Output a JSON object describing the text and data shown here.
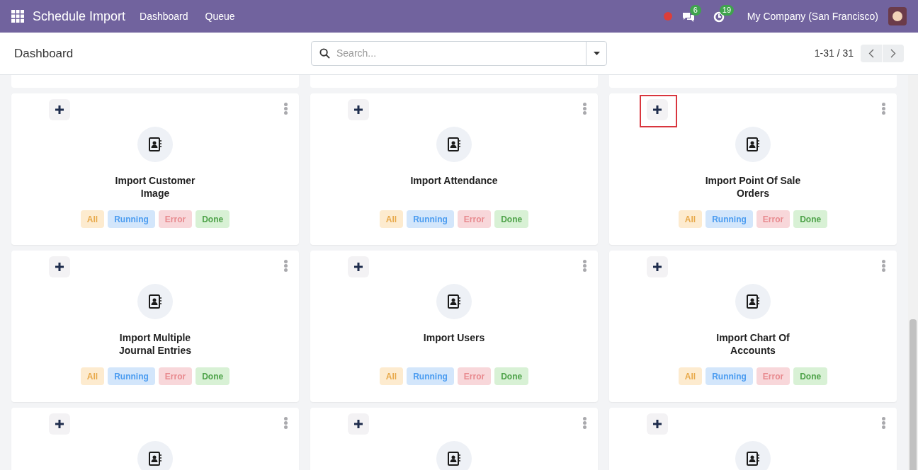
{
  "navbar": {
    "app_name": "Schedule Import",
    "menu": [
      "Dashboard",
      "Queue"
    ],
    "messages_count": "6",
    "activities_count": "19",
    "company": "My Company (San Francisco)"
  },
  "control_panel": {
    "title": "Dashboard",
    "search": {
      "placeholder": "Search..."
    },
    "pager": "1-31 / 31"
  },
  "cards": [
    {
      "title": "Import Customer Image",
      "highlighted": false,
      "filters": [
        "All",
        "Running",
        "Error",
        "Done"
      ]
    },
    {
      "title": "Import Attendance",
      "highlighted": false,
      "filters": [
        "All",
        "Running",
        "Error",
        "Done"
      ]
    },
    {
      "title": "Import Point Of Sale Orders",
      "highlighted": true,
      "filters": [
        "All",
        "Running",
        "Error",
        "Done"
      ]
    },
    {
      "title": "Import Multiple Journal Entries",
      "highlighted": false,
      "filters": [
        "All",
        "Running",
        "Error",
        "Done"
      ]
    },
    {
      "title": "Import Users",
      "highlighted": false,
      "filters": [
        "All",
        "Running",
        "Error",
        "Done"
      ]
    },
    {
      "title": "Import Chart Of Accounts",
      "highlighted": false,
      "filters": [
        "All",
        "Running",
        "Error",
        "Done"
      ]
    },
    {
      "highlighted": false
    },
    {
      "highlighted": false
    },
    {
      "highlighted": false
    }
  ]
}
